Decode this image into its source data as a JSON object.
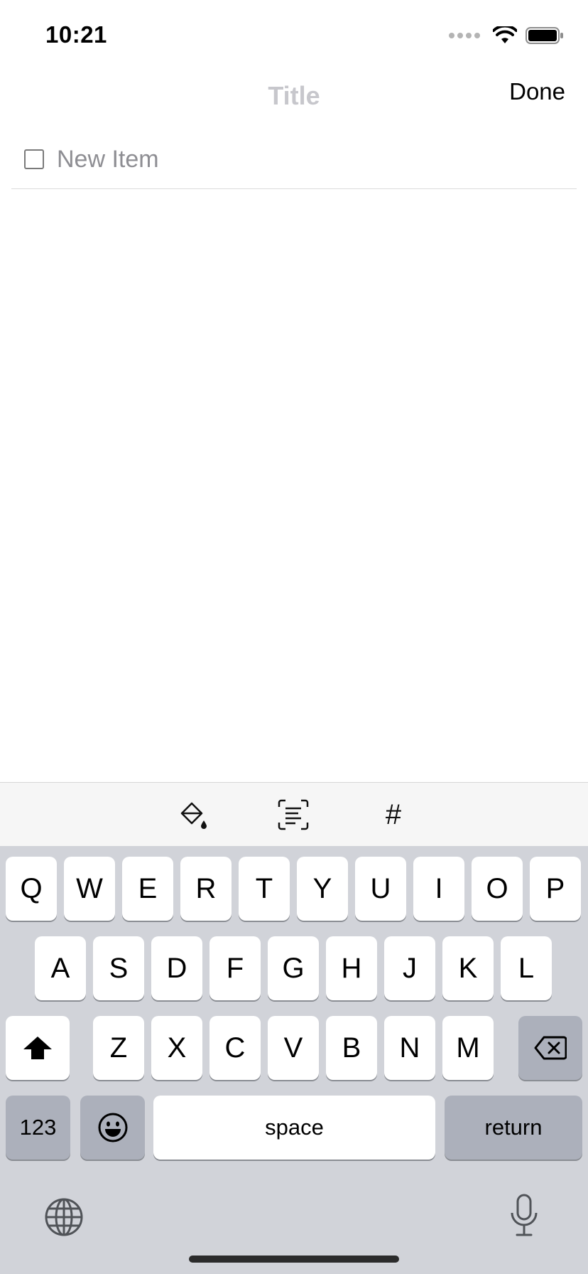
{
  "status_bar": {
    "time": "10:21"
  },
  "nav": {
    "title_placeholder": "Title",
    "done_label": "Done"
  },
  "checklist": {
    "new_item_placeholder": "New Item"
  },
  "toolbar": {
    "hash_label": "#"
  },
  "keyboard": {
    "row1": [
      "Q",
      "W",
      "E",
      "R",
      "T",
      "Y",
      "U",
      "I",
      "O",
      "P"
    ],
    "row2": [
      "A",
      "S",
      "D",
      "F",
      "G",
      "H",
      "J",
      "K",
      "L"
    ],
    "row3": [
      "Z",
      "X",
      "C",
      "V",
      "B",
      "N",
      "M"
    ],
    "numbers_label": "123",
    "space_label": "space",
    "return_label": "return"
  }
}
